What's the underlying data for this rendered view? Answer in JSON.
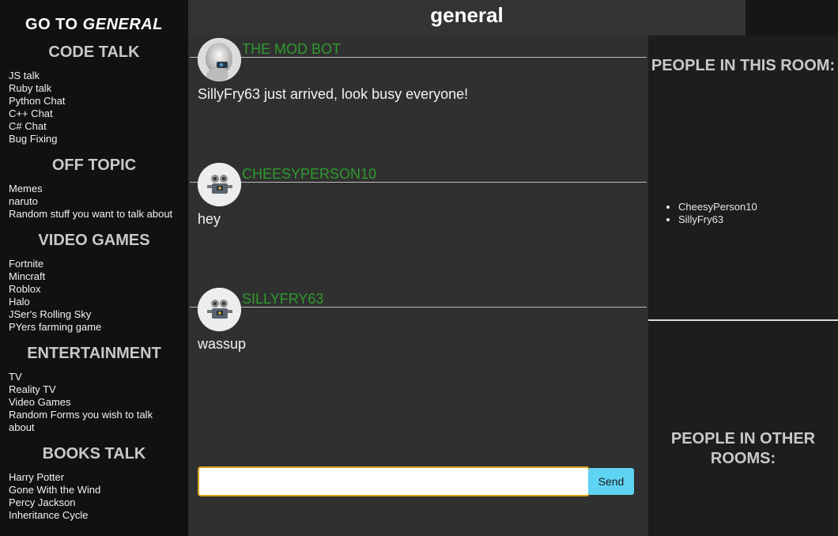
{
  "sidebar": {
    "goto_prefix": "GO TO",
    "goto_room": "GENERAL",
    "categories": [
      {
        "title": "CODE TALK",
        "rooms": [
          "JS talk",
          "Ruby talk",
          "Python Chat",
          "C++ Chat",
          "C# Chat",
          "Bug Fixing"
        ]
      },
      {
        "title": "OFF TOPIC",
        "rooms": [
          "Memes",
          "naruto",
          "Random stuff you want to talk about"
        ]
      },
      {
        "title": "VIDEO GAMES",
        "rooms": [
          "Fortnite",
          "Mincraft",
          "Roblox",
          "Halo",
          "JSer's Rolling Sky",
          "PYers farming game"
        ]
      },
      {
        "title": "ENTERTAINMENT",
        "rooms": [
          "TV",
          "Reality TV",
          "Video Games",
          "Random Forms you wish to talk about"
        ]
      },
      {
        "title": "BOOKS TALK",
        "rooms": [
          "Harry Potter",
          "Gone With the Wind",
          "Percy Jackson",
          "Inheritance Cycle"
        ]
      }
    ]
  },
  "room": {
    "title": "general"
  },
  "messages": [
    {
      "user": "THE MOD BOT",
      "text": "SillyFry63 just arrived, look busy everyone!",
      "avatar": "robot-head-avatar"
    },
    {
      "user": "CHEESYPERSON10",
      "text": "hey",
      "avatar": "robot-avatar"
    },
    {
      "user": "SILLYFRY63",
      "text": "wassup",
      "avatar": "robot-avatar"
    }
  ],
  "composer": {
    "value": "",
    "send_label": "Send"
  },
  "right_panel": {
    "in_room_title": "PEOPLE IN THIS ROOM:",
    "people_in_room": [
      "CheesyPerson10",
      "SillyFry63"
    ],
    "other_rooms_title": "PEOPLE IN OTHER ROOMS:"
  },
  "colors": {
    "username": "#2e9a2e",
    "send_button": "#5fd3f2",
    "input_border": "#e0a31a"
  }
}
